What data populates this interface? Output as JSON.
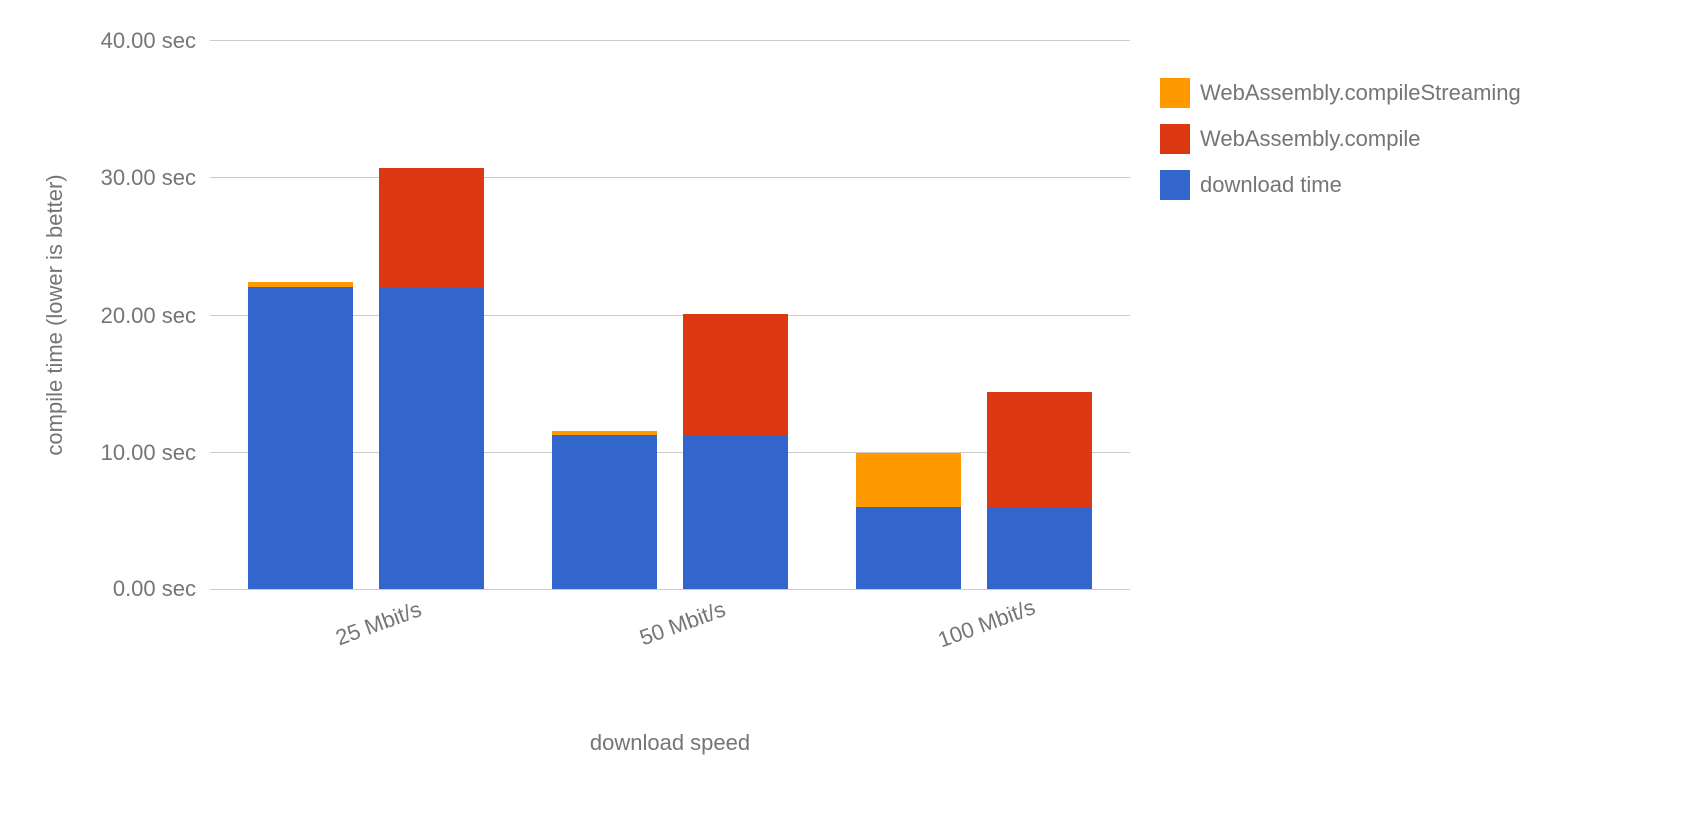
{
  "chart_data": {
    "type": "bar",
    "stacked": true,
    "categories": [
      "25 Mbit/s",
      "50 Mbit/s",
      "100 Mbit/s"
    ],
    "series": [
      {
        "name": "download time",
        "color": "#3366cc"
      },
      {
        "name": "WebAssembly.compile",
        "color": "#dc3912"
      },
      {
        "name": "WebAssembly.compileStreaming",
        "color": "#ff9900"
      }
    ],
    "bars": [
      {
        "category": "25 Mbit/s",
        "variant": "streaming",
        "download": 22.0,
        "compileStreaming": 0.3,
        "compile": 0
      },
      {
        "category": "25 Mbit/s",
        "variant": "compile",
        "download": 22.0,
        "compileStreaming": 0,
        "compile": 8.6
      },
      {
        "category": "50 Mbit/s",
        "variant": "streaming",
        "download": 11.2,
        "compileStreaming": 0.3,
        "compile": 0
      },
      {
        "category": "50 Mbit/s",
        "variant": "compile",
        "download": 11.2,
        "compileStreaming": 0,
        "compile": 8.8
      },
      {
        "category": "100 Mbit/s",
        "variant": "streaming",
        "download": 6.0,
        "compileStreaming": 3.9,
        "compile": 0
      },
      {
        "category": "100 Mbit/s",
        "variant": "compile",
        "download": 6.0,
        "compileStreaming": 0,
        "compile": 8.3
      }
    ],
    "ylabel": "compile time (lower is better)",
    "xlabel": "download speed",
    "ylim": [
      0,
      40
    ],
    "yticks": [
      0,
      10,
      20,
      30,
      40
    ],
    "ytick_labels": [
      "0.00 sec",
      "10.00 sec",
      "20.00 sec",
      "30.00 sec",
      "40.00 sec"
    ]
  },
  "legend": {
    "items": [
      "WebAssembly.compileStreaming",
      "WebAssembly.compile",
      "download time"
    ]
  }
}
